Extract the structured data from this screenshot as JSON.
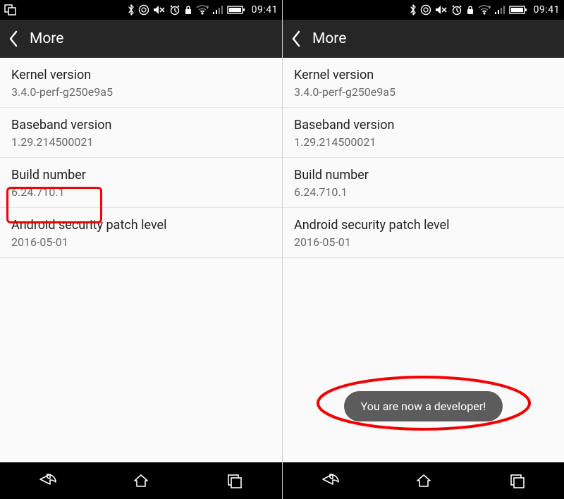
{
  "statusbar": {
    "time": "09:41"
  },
  "appbar": {
    "title": "More"
  },
  "rows": {
    "kernel": {
      "label": "Kernel version",
      "value": "3.4.0-perf-g250e9a5"
    },
    "baseband": {
      "label": "Baseband version",
      "value": "1.29.214500021"
    },
    "build": {
      "label": "Build number",
      "value": "6.24.710.1"
    },
    "patch": {
      "label": "Android security patch level",
      "value": "2016-05-01"
    }
  },
  "toast": {
    "message": "You are now a developer!"
  }
}
